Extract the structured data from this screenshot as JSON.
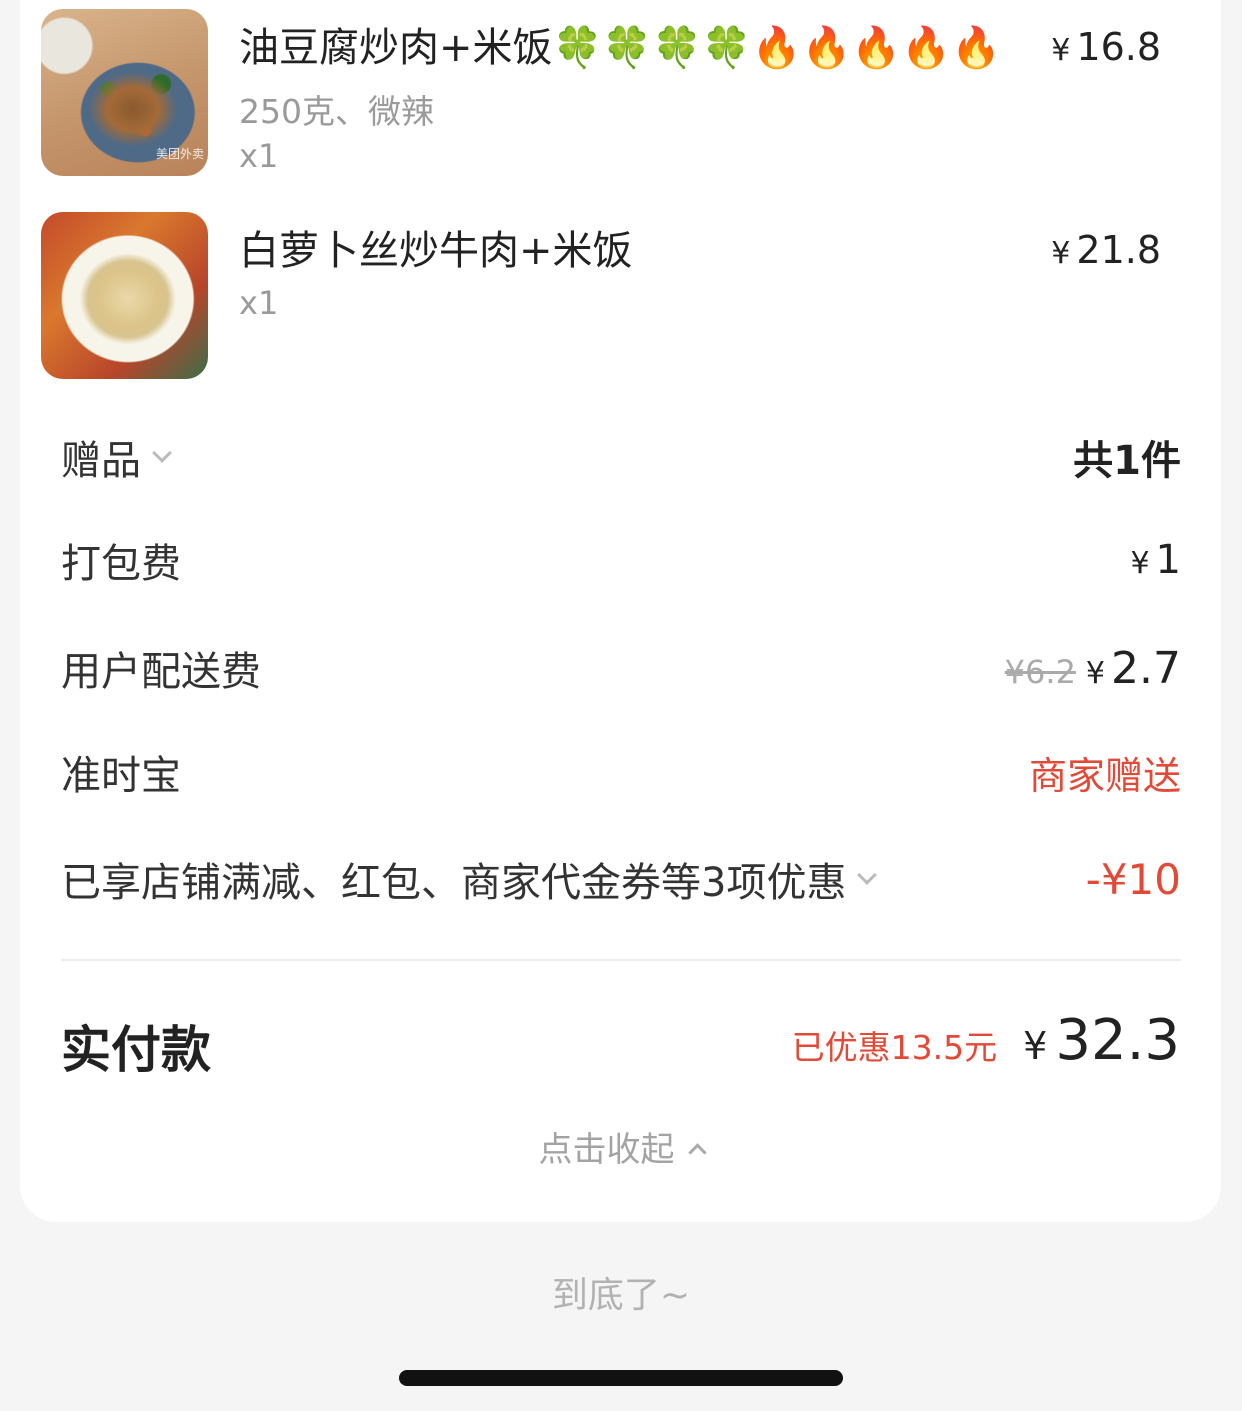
{
  "items": [
    {
      "name": "油豆腐炒肉+米饭🍀🍀🍀🍀🔥🔥🔥🔥🔥",
      "spec": "250克、微辣",
      "qty": "x1",
      "currency": "¥",
      "price": "16.8",
      "thumb_tag": "美团外卖"
    },
    {
      "name": "白萝卜丝炒牛肉+米饭",
      "qty": "x1",
      "currency": "¥",
      "price": "21.8"
    }
  ],
  "gift": {
    "label": "赠品",
    "value": "共1件"
  },
  "packing": {
    "label": "打包费",
    "currency": "¥",
    "value": "1"
  },
  "delivery": {
    "label": "用户配送费",
    "original": "¥6.2",
    "currency": "¥",
    "value": "2.7"
  },
  "ontime": {
    "label": "准时宝",
    "value": "商家赠送"
  },
  "discount": {
    "label": "已享店铺满减、红包、商家代金券等3项优惠",
    "value": "-¥10"
  },
  "total": {
    "label": "实付款",
    "saved": "已优惠13.5元",
    "currency": "¥",
    "value": "32.3"
  },
  "collapse_label": "点击收起",
  "bottom_text": "到底了~",
  "colors": {
    "accent_red": "#e24a37",
    "background": "#f5f5f5",
    "card": "#ffffff"
  }
}
